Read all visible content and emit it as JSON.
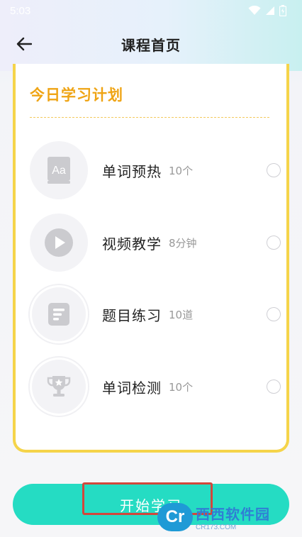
{
  "status_bar": {
    "time": "5:03"
  },
  "header": {
    "title": "课程首页"
  },
  "plan": {
    "title": "今日学习计划",
    "items": [
      {
        "label": "单词预热",
        "meta": "10个",
        "icon": "word-card-icon"
      },
      {
        "label": "视频教学",
        "meta": "8分钟",
        "icon": "play-icon"
      },
      {
        "label": "题目练习",
        "meta": "10道",
        "icon": "exercise-icon"
      },
      {
        "label": "单词检测",
        "meta": "10个",
        "icon": "trophy-icon"
      }
    ]
  },
  "start_button": {
    "label": "开始学习"
  },
  "watermark": {
    "brand": "西西软件园",
    "url": "CR173.COM"
  },
  "colors": {
    "accent_yellow": "#f5d44a",
    "title_orange": "#efa414",
    "button_teal": "#25dcc3",
    "highlight_red": "#d2473b"
  }
}
